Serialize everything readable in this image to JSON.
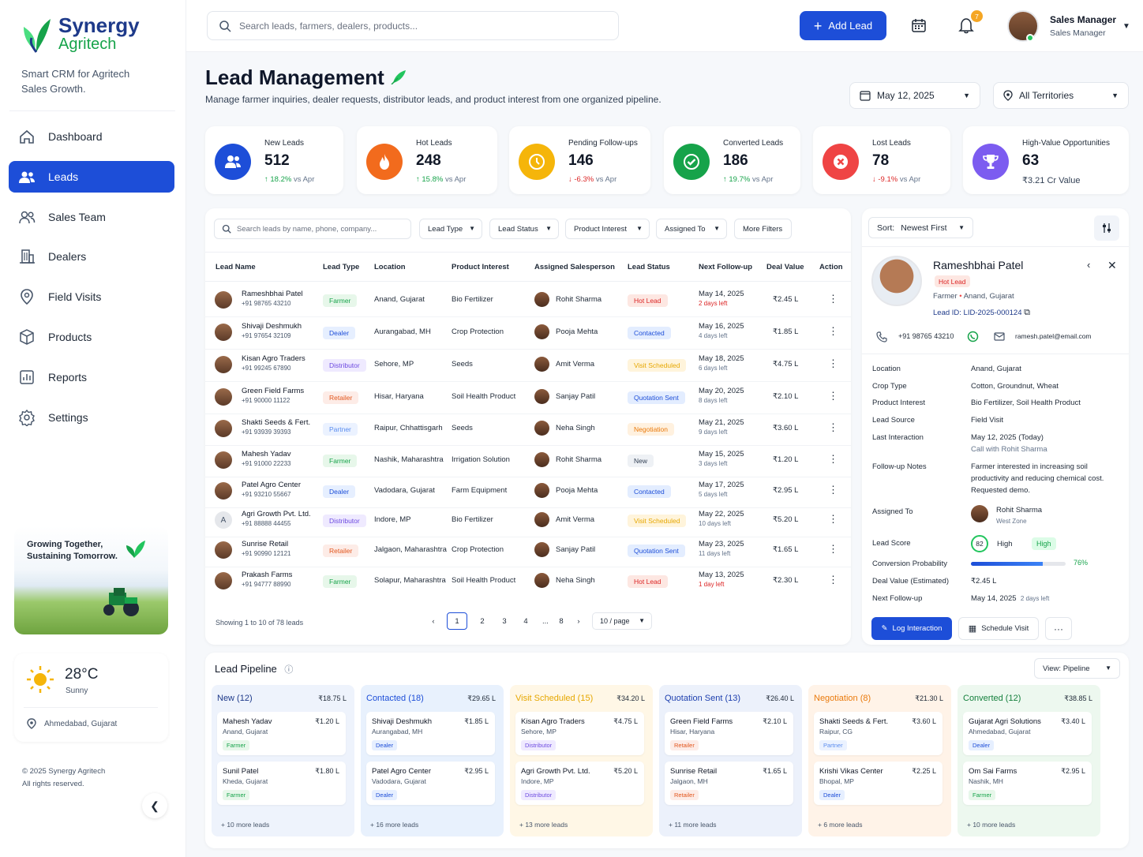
{
  "brand": {
    "name": "Synergy",
    "sub": "Agritech",
    "tagline": "Smart CRM for Agritech Sales Growth."
  },
  "nav": [
    {
      "label": "Dashboard",
      "icon": "home-icon"
    },
    {
      "label": "Leads",
      "icon": "users-icon",
      "active": true
    },
    {
      "label": "Sales Team",
      "icon": "team-icon"
    },
    {
      "label": "Dealers",
      "icon": "building-icon"
    },
    {
      "label": "Field Visits",
      "icon": "location-pin-icon"
    },
    {
      "label": "Products",
      "icon": "box-icon"
    },
    {
      "label": "Reports",
      "icon": "report-icon"
    },
    {
      "label": "Settings",
      "icon": "gear-icon"
    }
  ],
  "promo": {
    "line1": "Growing Together,",
    "line2": "Sustaining Tomorrow."
  },
  "weather": {
    "temp": "28°C",
    "cond": "Sunny",
    "loc": "Ahmedabad, Gujarat"
  },
  "footer": {
    "line1": "© 2025 Synergy Agritech",
    "line2": "All rights reserved."
  },
  "top": {
    "search_placeholder": "Search leads, farmers, dealers, products...",
    "add_lead": "Add Lead",
    "notif": "7",
    "user": "Sales Manager",
    "role": "Sales Manager"
  },
  "page": {
    "title": "Lead Management",
    "subtitle": "Manage farmer inquiries, dealer requests, distributor leads, and product interest from one organized pipeline.",
    "date": "May 12, 2025",
    "territory": "All Territories"
  },
  "kpis": [
    {
      "label": "New Leads",
      "value": "512",
      "delta": "18.2%",
      "suffix": "vs Apr",
      "dir": "up",
      "color": "#1d4ed8",
      "icon": "users-icon"
    },
    {
      "label": "Hot Leads",
      "value": "248",
      "delta": "15.8%",
      "suffix": "vs Apr",
      "dir": "up",
      "color": "#f26b1d",
      "icon": "fire-icon"
    },
    {
      "label": "Pending Follow-ups",
      "value": "146",
      "delta": "-6.3%",
      "suffix": "vs Apr",
      "dir": "dn",
      "color": "#f5b50a",
      "icon": "clock-icon"
    },
    {
      "label": "Converted Leads",
      "value": "186",
      "delta": "19.7%",
      "suffix": "vs Apr",
      "dir": "up",
      "color": "#16a34a",
      "icon": "check-icon"
    },
    {
      "label": "Lost Leads",
      "value": "78",
      "delta": "-9.1%",
      "suffix": "vs Apr",
      "dir": "dn",
      "color": "#ef4444",
      "icon": "x-icon"
    },
    {
      "label": "High-Value Opportunities",
      "value": "63",
      "delta": "₹3.21 Cr Value",
      "suffix": "",
      "dir": "none",
      "color": "#7c5cf0",
      "icon": "trophy-icon"
    }
  ],
  "filters": {
    "search_placeholder": "Search leads by name, phone, company...",
    "lead_type": "Lead Type",
    "lead_status": "Lead Status",
    "product_interest": "Product Interest",
    "assigned_to": "Assigned To",
    "more": "More Filters"
  },
  "table": {
    "headers": [
      "Lead Name",
      "Lead Type",
      "Location",
      "Product Interest",
      "Assigned Salesperson",
      "Lead Status",
      "Next Follow-up",
      "Deal Value",
      "Action"
    ],
    "rows": [
      {
        "name": "Rameshbhai Patel",
        "phone": "+91 98765 43210",
        "type": "Farmer",
        "location": "Anand, Gujarat",
        "product": "Bio Fertilizer",
        "sales": "Rohit Sharma",
        "status": "Hot Lead",
        "date": "May 14, 2025",
        "left": "2 days left",
        "value": "₹2.45 L",
        "urgent": true
      },
      {
        "name": "Shivaji Deshmukh",
        "phone": "+91 97654 32109",
        "type": "Dealer",
        "location": "Aurangabad, MH",
        "product": "Crop Protection",
        "sales": "Pooja Mehta",
        "status": "Contacted",
        "date": "May 16, 2025",
        "left": "4 days left",
        "value": "₹1.85 L"
      },
      {
        "name": "Kisan Agro Traders",
        "phone": "+91 99245 67890",
        "type": "Distributor",
        "location": "Sehore, MP",
        "product": "Seeds",
        "sales": "Amit Verma",
        "status": "Visit Scheduled",
        "date": "May 18, 2025",
        "left": "6 days left",
        "value": "₹4.75 L"
      },
      {
        "name": "Green Field Farms",
        "phone": "+91 90000 11122",
        "type": "Retailer",
        "location": "Hisar, Haryana",
        "product": "Soil Health Product",
        "sales": "Sanjay Patil",
        "status": "Quotation Sent",
        "date": "May 20, 2025",
        "left": "8 days left",
        "value": "₹2.10 L"
      },
      {
        "name": "Shakti Seeds & Fert.",
        "phone": "+91 93939 39393",
        "type": "Partner",
        "location": "Raipur, Chhattisgarh",
        "product": "Seeds",
        "sales": "Neha Singh",
        "status": "Negotiation",
        "date": "May 21, 2025",
        "left": "9 days left",
        "value": "₹3.60 L"
      },
      {
        "name": "Mahesh Yadav",
        "phone": "+91 91000 22233",
        "type": "Farmer",
        "location": "Nashik, Maharashtra",
        "product": "Irrigation Solution",
        "sales": "Rohit Sharma",
        "status": "New",
        "date": "May 15, 2025",
        "left": "3 days left",
        "value": "₹1.20 L"
      },
      {
        "name": "Patel Agro Center",
        "phone": "+91 93210 55667",
        "type": "Dealer",
        "location": "Vadodara, Gujarat",
        "product": "Farm Equipment",
        "sales": "Pooja Mehta",
        "status": "Contacted",
        "date": "May 17, 2025",
        "left": "5 days left",
        "value": "₹2.95 L"
      },
      {
        "name": "Agri Growth Pvt. Ltd.",
        "phone": "+91 88888 44455",
        "type": "Distributor",
        "location": "Indore, MP",
        "product": "Bio Fertilizer",
        "sales": "Amit Verma",
        "status": "Visit Scheduled",
        "date": "May 22, 2025",
        "left": "10 days left",
        "value": "₹5.20 L",
        "initial": "A"
      },
      {
        "name": "Sunrise Retail",
        "phone": "+91 90990 12121",
        "type": "Retailer",
        "location": "Jalgaon, Maharashtra",
        "product": "Crop Protection",
        "sales": "Sanjay Patil",
        "status": "Quotation Sent",
        "date": "May 23, 2025",
        "left": "11 days left",
        "value": "₹1.65 L"
      },
      {
        "name": "Prakash Farms",
        "phone": "+91 94777 88990",
        "type": "Farmer",
        "location": "Solapur, Maharashtra",
        "product": "Soil Health Product",
        "sales": "Neha Singh",
        "status": "Hot Lead",
        "date": "May 13, 2025",
        "left": "1 day left",
        "value": "₹2.30 L",
        "urgent": true
      }
    ],
    "showing": "Showing 1 to 10 of 78 leads",
    "pages": [
      "1",
      "2",
      "3",
      "4",
      "...",
      "8"
    ],
    "page_size": "10 / page"
  },
  "detail": {
    "sort_label": "Sort:",
    "sort_value": "Newest First",
    "name": "Rameshbhai Patel",
    "badge": "Hot Lead",
    "type": "Farmer",
    "location_short": "Anand, Gujarat",
    "lead_id": "Lead ID: LID-2025-000124",
    "phone": "+91 98765 43210",
    "email": "ramesh.patel@email.com",
    "fields": {
      "location_k": "Location",
      "location": "Anand, Gujarat",
      "crop_k": "Crop Type",
      "crop": "Cotton, Groundnut, Wheat",
      "product_k": "Product Interest",
      "product": "Bio Fertilizer, Soil Health Product",
      "source_k": "Lead Source",
      "source": "Field Visit",
      "last_k": "Last Interaction",
      "last": "May 12, 2025 (Today)",
      "last_sub": "Call with Rohit Sharma",
      "notes_k": "Follow-up Notes",
      "notes": "Farmer interested in increasing soil productivity and reducing chemical cost. Requested demo.",
      "assigned_k": "Assigned To",
      "assigned": "Rohit Sharma",
      "assigned_zone": "West Zone",
      "score_k": "Lead Score",
      "score": "82",
      "score_label": "High",
      "score_badge": "High",
      "prob_k": "Conversion Probability",
      "prob": "76%",
      "prob_value": 0.76,
      "deal_k": "Deal Value (Estimated)",
      "deal": "₹2.45 L",
      "next_k": "Next Follow-up",
      "next": "May 14, 2025",
      "next_left": "2 days left"
    },
    "log": "Log Interaction",
    "schedule": "Schedule Visit",
    "more": "···"
  },
  "pipeline": {
    "title": "Lead Pipeline",
    "view_label": "View:",
    "view": "Pipeline",
    "columns": [
      {
        "name": "New (12)",
        "value": "₹18.75 L",
        "color": "#1e3a8a",
        "bg": "#eef3fc",
        "more": "+ 10 more leads",
        "cards": [
          {
            "n": "Mahesh Yadav",
            "v": "₹1.20 L",
            "l": "Anand, Gujarat",
            "t": "Farmer"
          },
          {
            "n": "Sunil Patel",
            "v": "₹1.80 L",
            "l": "Kheda, Gujarat",
            "t": "Farmer"
          }
        ]
      },
      {
        "name": "Contacted (18)",
        "value": "₹29.65 L",
        "color": "#1d4ed8",
        "bg": "#e8f1fd",
        "more": "+ 16 more leads",
        "cards": [
          {
            "n": "Shivaji Deshmukh",
            "v": "₹1.85 L",
            "l": "Aurangabad, MH",
            "t": "Dealer"
          },
          {
            "n": "Patel Agro Center",
            "v": "₹2.95 L",
            "l": "Vadodara, Gujarat",
            "t": "Dealer"
          }
        ]
      },
      {
        "name": "Visit Scheduled (15)",
        "value": "₹34.20 L",
        "color": "#e6a700",
        "bg": "#fff7e6",
        "more": "+ 13 more leads",
        "cards": [
          {
            "n": "Kisan Agro Traders",
            "v": "₹4.75 L",
            "l": "Sehore, MP",
            "t": "Distributor"
          },
          {
            "n": "Agri Growth Pvt. Ltd.",
            "v": "₹5.20 L",
            "l": "Indore, MP",
            "t": "Distributor"
          }
        ]
      },
      {
        "name": "Quotation Sent (13)",
        "value": "₹26.40 L",
        "color": "#1e40af",
        "bg": "#ecf1fb",
        "more": "+ 11 more leads",
        "cards": [
          {
            "n": "Green Field Farms",
            "v": "₹2.10 L",
            "l": "Hisar, Haryana",
            "t": "Retailer"
          },
          {
            "n": "Sunrise Retail",
            "v": "₹1.65 L",
            "l": "Jalgaon, MH",
            "t": "Retailer"
          }
        ]
      },
      {
        "name": "Negotiation (8)",
        "value": "₹21.30 L",
        "color": "#ea7a0c",
        "bg": "#fff3e8",
        "more": "+ 6 more leads",
        "cards": [
          {
            "n": "Shakti Seeds & Fert.",
            "v": "₹3.60 L",
            "l": "Raipur, CG",
            "t": "Partner"
          },
          {
            "n": "Krishi Vikas Center",
            "v": "₹2.25 L",
            "l": "Bhopal, MP",
            "t": "Dealer"
          }
        ]
      },
      {
        "name": "Converted (12)",
        "value": "₹38.85 L",
        "color": "#15803d",
        "bg": "#edf8ef",
        "more": "+ 10 more leads",
        "cards": [
          {
            "n": "Gujarat Agri Solutions",
            "v": "₹3.40 L",
            "l": "Ahmedabad, Gujarat",
            "t": "Dealer"
          },
          {
            "n": "Om Sai Farms",
            "v": "₹2.95 L",
            "l": "Nashik, MH",
            "t": "Farmer"
          }
        ]
      }
    ]
  },
  "type_colors": {
    "Farmer": [
      "#e7f7ea",
      "#16a34a"
    ],
    "Dealer": [
      "#e6efff",
      "#1d4ed8"
    ],
    "Distributor": [
      "#efeaff",
      "#6d4ae0"
    ],
    "Retailer": [
      "#fdece7",
      "#e2561d"
    ],
    "Partner": [
      "#ebf2ff",
      "#5b8def"
    ]
  },
  "status_colors": {
    "Hot Lead": [
      "#fde7e2",
      "#dc2626"
    ],
    "Contacted": [
      "#e3edff",
      "#1d4ed8"
    ],
    "Visit Scheduled": [
      "#fff4db",
      "#e6a700"
    ],
    "Quotation Sent": [
      "#e3edff",
      "#1d4ed8"
    ],
    "Negotiation": [
      "#fff1df",
      "#ea7a0c"
    ],
    "New": [
      "#eef1f5",
      "#334155"
    ]
  }
}
